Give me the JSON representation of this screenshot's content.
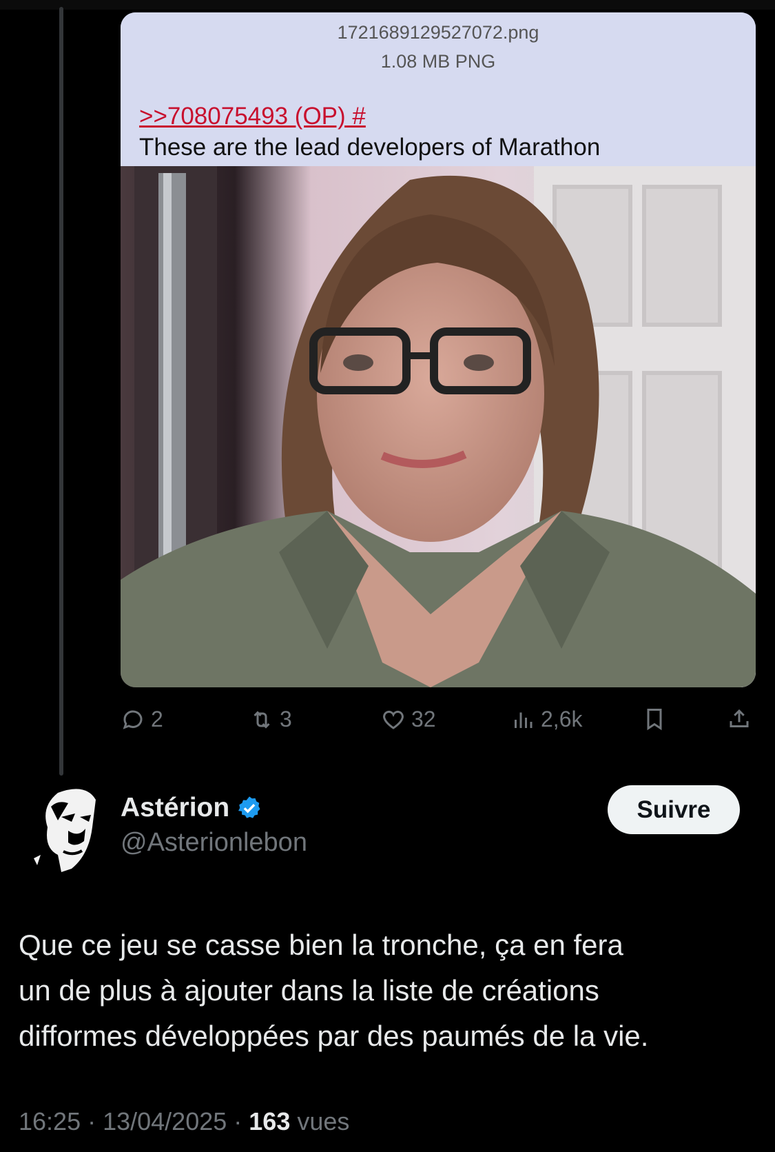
{
  "media": {
    "file_name": "1721689129527072.png",
    "file_meta": "1.08 MB PNG",
    "quote_link": ">>708075493 (OP) #",
    "post_text": "These are the lead developers of Marathon"
  },
  "parent_actions": {
    "replies": "2",
    "reposts": "3",
    "likes": "32",
    "views": "2,6k"
  },
  "icons": {
    "reply": "reply-icon",
    "repost": "repost-icon",
    "like": "heart-icon",
    "views": "views-icon",
    "bookmark": "bookmark-icon",
    "share": "share-icon",
    "verified": "verified-badge-icon"
  },
  "author": {
    "display_name": "Astérion",
    "handle": "@Asterionlebon",
    "follow_label": "Suivre"
  },
  "tweet": {
    "lines": [
      "Que ce jeu se casse bien la tronche, ça en fera",
      "un de plus à ajouter dans la liste de créations",
      "difformes développées par des paumés de la vie."
    ]
  },
  "meta": {
    "time": "16:25",
    "sep1": " · ",
    "date": "13/04/2025",
    "sep2": " · ",
    "views_count": "163",
    "views_label": " vues"
  },
  "colors": {
    "background": "#000000",
    "text_primary": "#e7e9ea",
    "text_secondary": "#71767b",
    "verified_blue": "#1d9bf0",
    "chan_bg": "#d6daf0",
    "chan_link": "#c8102e"
  }
}
